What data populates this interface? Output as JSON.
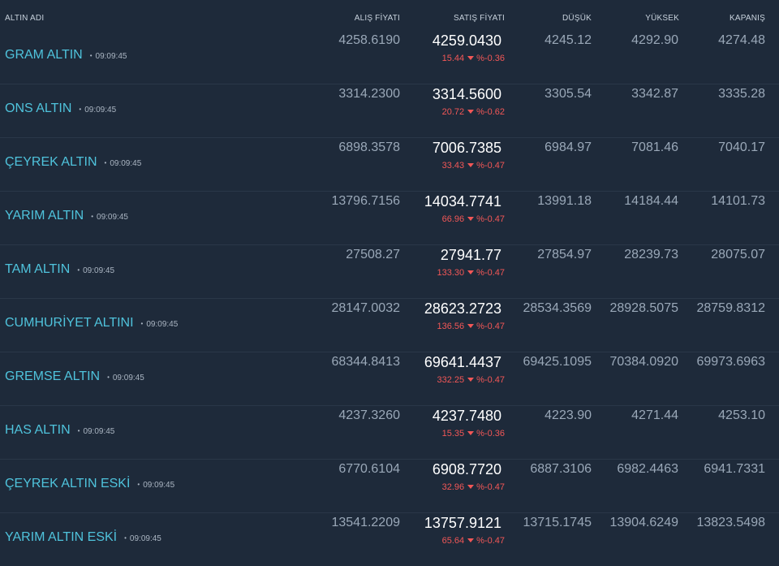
{
  "header": {
    "name": "ALTIN ADI",
    "alis": "ALIŞ FİYATI",
    "satis": "SATIŞ FİYATI",
    "dusuk": "DÜŞÜK",
    "yuksek": "YÜKSEK",
    "kapanis": "KAPANIŞ"
  },
  "colors": {
    "background": "#1e2a3a",
    "name": "#4fc3dc",
    "price": "#ffffff",
    "muted": "#9aa8b8",
    "change_negative": "#f25757"
  },
  "rows": [
    {
      "name": "GRAM ALTIN",
      "time": "09:09:45",
      "alis": "4258.6190",
      "satis": "4259.0430",
      "change": "15.44",
      "pct": "%-0.36",
      "dusuk": "4245.12",
      "yuksek": "4292.90",
      "kapanis": "4274.48"
    },
    {
      "name": "ONS ALTIN",
      "time": "09:09:45",
      "alis": "3314.2300",
      "satis": "3314.5600",
      "change": "20.72",
      "pct": "%-0.62",
      "dusuk": "3305.54",
      "yuksek": "3342.87",
      "kapanis": "3335.28"
    },
    {
      "name": "ÇEYREK ALTIN",
      "time": "09:09:45",
      "alis": "6898.3578",
      "satis": "7006.7385",
      "change": "33.43",
      "pct": "%-0.47",
      "dusuk": "6984.97",
      "yuksek": "7081.46",
      "kapanis": "7040.17"
    },
    {
      "name": "YARIM ALTIN",
      "time": "09:09:45",
      "alis": "13796.7156",
      "satis": "14034.7741",
      "change": "66.96",
      "pct": "%-0.47",
      "dusuk": "13991.18",
      "yuksek": "14184.44",
      "kapanis": "14101.73"
    },
    {
      "name": "TAM ALTIN",
      "time": "09:09:45",
      "alis": "27508.27",
      "satis": "27941.77",
      "change": "133.30",
      "pct": "%-0.47",
      "dusuk": "27854.97",
      "yuksek": "28239.73",
      "kapanis": "28075.07"
    },
    {
      "name": "CUMHURİYET ALTINI",
      "time": "09:09:45",
      "alis": "28147.0032",
      "satis": "28623.2723",
      "change": "136.56",
      "pct": "%-0.47",
      "dusuk": "28534.3569",
      "yuksek": "28928.5075",
      "kapanis": "28759.8312"
    },
    {
      "name": "GREMSE ALTIN",
      "time": "09:09:45",
      "alis": "68344.8413",
      "satis": "69641.4437",
      "change": "332.25",
      "pct": "%-0.47",
      "dusuk": "69425.1095",
      "yuksek": "70384.0920",
      "kapanis": "69973.6963"
    },
    {
      "name": "HAS ALTIN",
      "time": "09:09:45",
      "alis": "4237.3260",
      "satis": "4237.7480",
      "change": "15.35",
      "pct": "%-0.36",
      "dusuk": "4223.90",
      "yuksek": "4271.44",
      "kapanis": "4253.10"
    },
    {
      "name": "ÇEYREK ALTIN ESKİ",
      "time": "09:09:45",
      "alis": "6770.6104",
      "satis": "6908.7720",
      "change": "32.96",
      "pct": "%-0.47",
      "dusuk": "6887.3106",
      "yuksek": "6982.4463",
      "kapanis": "6941.7331"
    },
    {
      "name": "YARIM ALTIN ESKİ",
      "time": "09:09:45",
      "alis": "13541.2209",
      "satis": "13757.9121",
      "change": "65.64",
      "pct": "%-0.47",
      "dusuk": "13715.1745",
      "yuksek": "13904.6249",
      "kapanis": "13823.5498"
    }
  ]
}
